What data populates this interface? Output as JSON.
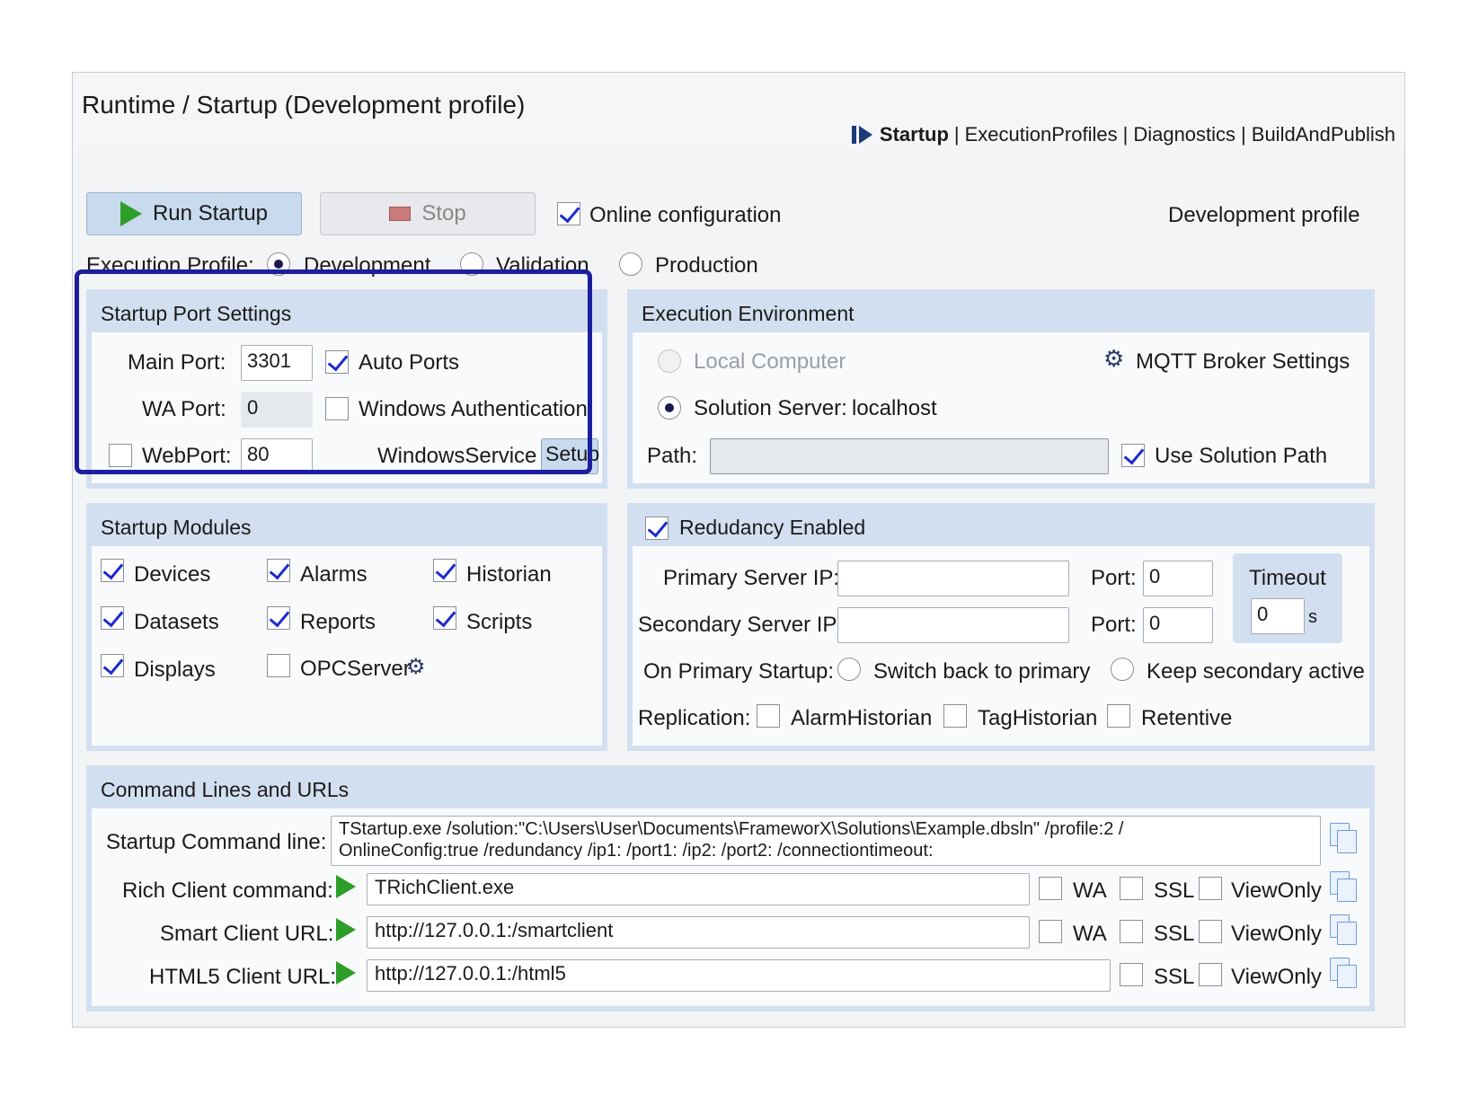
{
  "window": {
    "title": "Runtime / Startup (Development profile)",
    "breadcrumb": [
      "Startup",
      "ExecutionProfiles",
      "Diagnostics",
      "BuildAndPublish"
    ],
    "breadcrumb_sep": "|"
  },
  "toolbar": {
    "run_label": "Run Startup",
    "stop_label": "Stop",
    "online_config_label": "Online configuration",
    "online_config_checked": true,
    "profile_status": "Development profile"
  },
  "execution_profile": {
    "label": "Execution Profile:",
    "options": [
      "Development",
      "Validation",
      "Production"
    ],
    "selected": "Development"
  },
  "startup_port_settings": {
    "title": "Startup Port Settings",
    "main_port_label": "Main Port:",
    "main_port_value": "3301",
    "auto_ports_label": "Auto Ports",
    "auto_ports_checked": true,
    "wa_port_label": "WA Port:",
    "wa_port_value": "0",
    "windows_auth_label": "Windows Authentication",
    "windows_auth_checked": false,
    "webport_label": "WebPort:",
    "webport_value": "80",
    "webport_checked": false,
    "windows_service_label": "WindowsService",
    "setup_label": "Setup"
  },
  "execution_environment": {
    "title": "Execution Environment",
    "local_computer_label": "Local Computer",
    "mqtt_label": "MQTT Broker Settings",
    "solution_server_label": "Solution Server:",
    "solution_server_value": "localhost",
    "path_label": "Path:",
    "path_value": "",
    "use_solution_path_label": "Use Solution Path",
    "use_solution_path_checked": true
  },
  "startup_modules": {
    "title": "Startup Modules",
    "items": [
      {
        "label": "Devices",
        "checked": true
      },
      {
        "label": "Alarms",
        "checked": true
      },
      {
        "label": "Historian",
        "checked": true
      },
      {
        "label": "Datasets",
        "checked": true
      },
      {
        "label": "Reports",
        "checked": true
      },
      {
        "label": "Scripts",
        "checked": true
      },
      {
        "label": "Displays",
        "checked": true
      },
      {
        "label": "OPCServer",
        "checked": false
      }
    ]
  },
  "redundancy": {
    "title": "Redudancy Enabled",
    "enabled": true,
    "primary_ip_label": "Primary Server IP:",
    "primary_ip_value": "",
    "primary_port_label": "Port:",
    "primary_port_value": "0",
    "secondary_ip_label": "Secondary Server IP:",
    "secondary_ip_value": "",
    "secondary_port_label": "Port:",
    "secondary_port_value": "0",
    "timeout_label": "Timeout",
    "timeout_value": "0",
    "timeout_unit": "s",
    "on_primary_label": "On Primary Startup:",
    "switch_back_label": "Switch back to primary",
    "keep_secondary_label": "Keep secondary active",
    "replication_label": "Replication:",
    "replication_items": [
      "AlarmHistorian",
      "TagHistorian",
      "Retentive"
    ]
  },
  "command_lines": {
    "title": "Command Lines and URLs",
    "startup_label": "Startup Command line:",
    "startup_value_line1": "TStartup.exe /solution:\"C:\\Users\\User\\Documents\\FrameworX\\Solutions\\Example.dbsln\" /profile:2 /",
    "startup_value_line2": "OnlineConfig:true /redundancy /ip1: /port1: /ip2: /port2: /connectiontimeout:",
    "rich_label": "Rich Client command:",
    "rich_value": "TRichClient.exe",
    "smart_label": "Smart Client URL:",
    "smart_value": "http://127.0.0.1:/smartclient",
    "html5_label": "HTML5 Client URL:",
    "html5_value": "http://127.0.0.1:/html5",
    "wa_label": "WA",
    "ssl_label": "SSL",
    "viewonly_label": "ViewOnly"
  }
}
